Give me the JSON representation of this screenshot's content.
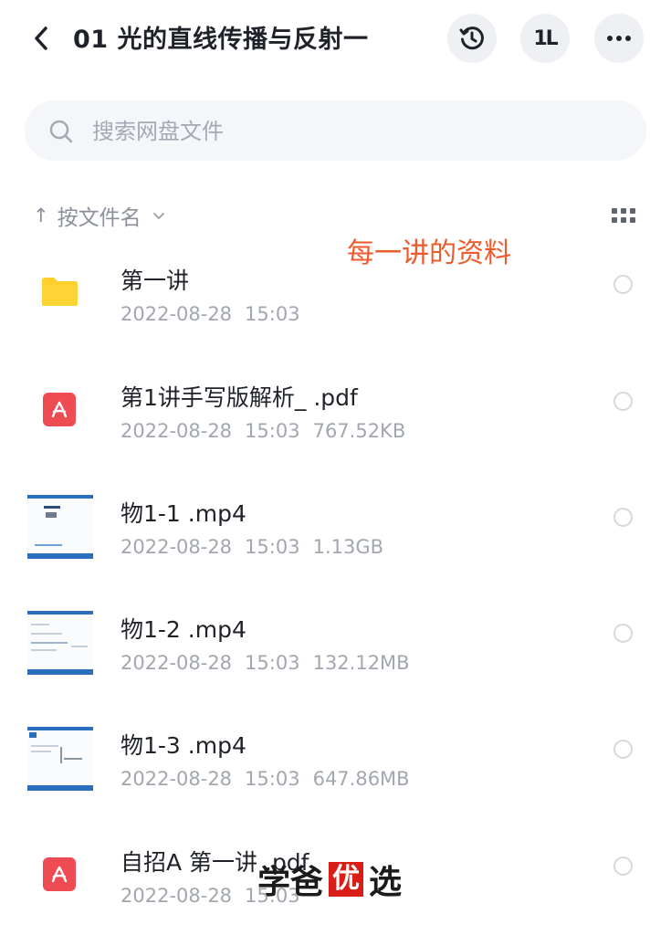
{
  "header": {
    "title": "01 光的直线传播与反射一",
    "back_icon": "chevron-left-icon",
    "history_icon": "history-icon",
    "sort_label": "1L",
    "more_icon": "more-icon"
  },
  "search": {
    "placeholder": "搜索网盘文件"
  },
  "sort_bar": {
    "arrow": "↑",
    "label": "按文件名"
  },
  "annotation": "每一讲的资料",
  "files": [
    {
      "name": "第一讲",
      "date": "2022-08-28",
      "time": "15:03",
      "size": "",
      "type": "folder"
    },
    {
      "name": "第1讲手写版解析_ .pdf",
      "date": "2022-08-28",
      "time": "15:03",
      "size": "767.52KB",
      "type": "pdf"
    },
    {
      "name": "物1-1 .mp4",
      "date": "2022-08-28",
      "time": "15:03",
      "size": "1.13GB",
      "type": "video"
    },
    {
      "name": "物1-2 .mp4",
      "date": "2022-08-28",
      "time": "15:03",
      "size": "132.12MB",
      "type": "video"
    },
    {
      "name": "物1-3 .mp4",
      "date": "2022-08-28",
      "time": "15:03",
      "size": "647.86MB",
      "type": "video"
    },
    {
      "name": "自招A 第一讲 .pdf",
      "date": "2022-08-28",
      "time": "15:03",
      "size": "",
      "type": "pdf"
    }
  ],
  "watermark": {
    "part1": "学爸",
    "part2": "优",
    "part3": "选"
  },
  "colors": {
    "accent_orange": "#ef5a2c",
    "folder_yellow": "#fdd02b",
    "pdf_red": "#ef4b52",
    "video_blue": "#2a6fbd"
  }
}
